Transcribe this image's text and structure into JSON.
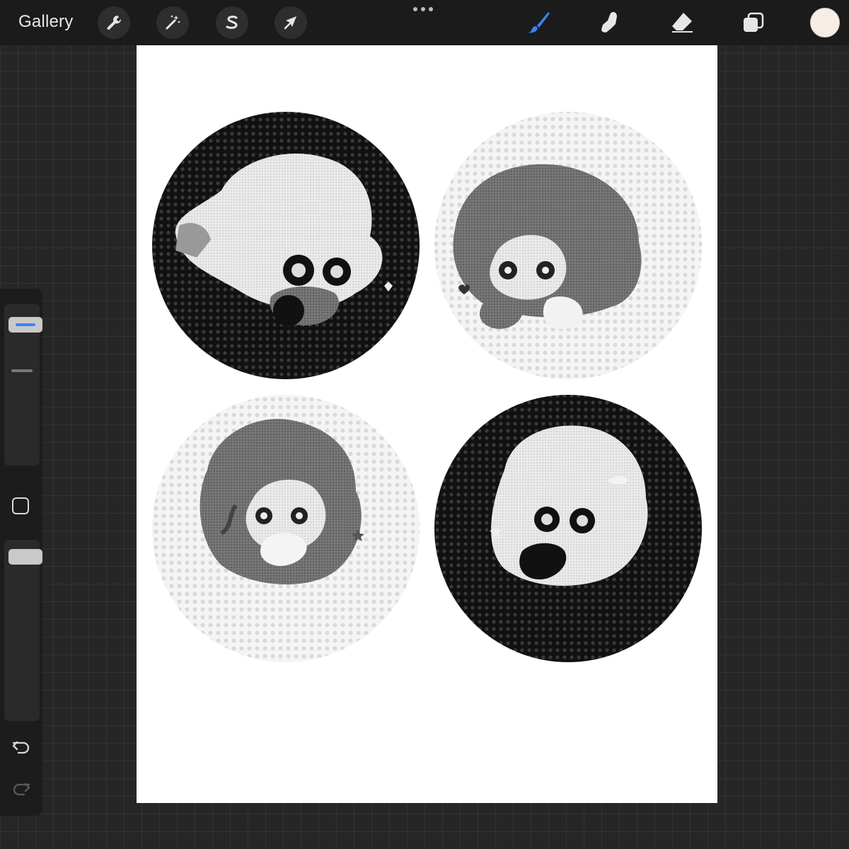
{
  "topbar": {
    "gallery_label": "Gallery",
    "left_tools": [
      {
        "name": "actions",
        "icon": "wrench-icon"
      },
      {
        "name": "adjustments",
        "icon": "magic-wand-icon"
      },
      {
        "name": "selection",
        "icon": "selection-s-icon"
      },
      {
        "name": "transform",
        "icon": "arrow-cursor-icon"
      }
    ],
    "right_tools": [
      {
        "name": "brush",
        "icon": "brush-icon",
        "active": true,
        "color": "#3b82f6"
      },
      {
        "name": "smudge",
        "icon": "smudge-finger-icon"
      },
      {
        "name": "eraser",
        "icon": "eraser-icon"
      },
      {
        "name": "layers",
        "icon": "layers-icon"
      }
    ],
    "current_color": "#f8ede4"
  },
  "sidebar": {
    "brush_size_accent": "#3b82f6",
    "tools": [
      "brush-size-slider",
      "modify-button",
      "opacity-slider",
      "undo-icon",
      "redo-icon"
    ]
  },
  "canvas": {
    "background": "#ffffff",
    "badges": [
      {
        "style": "dark",
        "pose": "hair-front"
      },
      {
        "style": "light",
        "pose": "hands-on-cheeks"
      },
      {
        "style": "light",
        "pose": "ribbon-pigtails"
      },
      {
        "style": "dark",
        "pose": "ribbon-pigtails"
      }
    ]
  }
}
